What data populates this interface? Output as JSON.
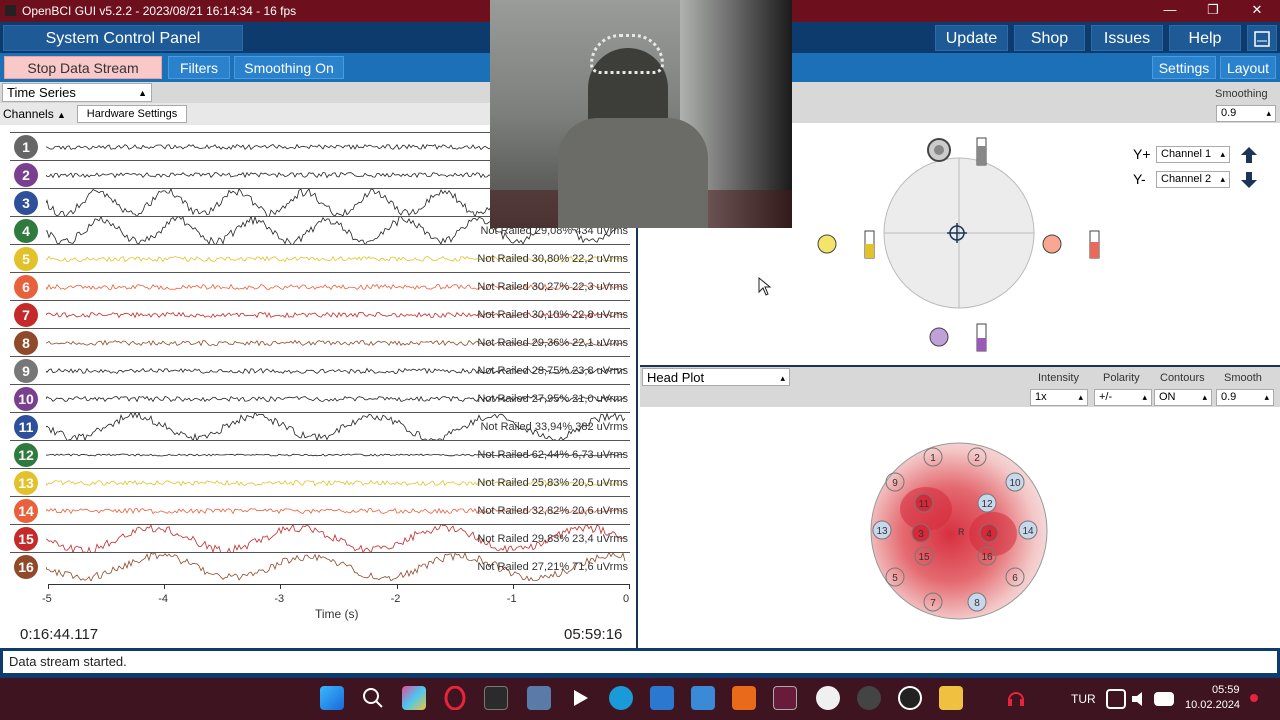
{
  "titlebar": {
    "title": "OpenBCI GUI v5.2.2 - 2023/08/21 16:14:34 - 16 fps",
    "minimize": "—",
    "restore": "❐",
    "close": "✕"
  },
  "nav": {
    "control_panel": "System Control Panel",
    "update": "Update",
    "shop": "Shop",
    "issues": "Issues",
    "help": "Help"
  },
  "toolbar": {
    "stop": "Stop Data Stream",
    "filters": "Filters",
    "smoothing": "Smoothing On",
    "settings": "Settings",
    "layout": "Layout"
  },
  "timeseries": {
    "widget": "Time Series",
    "channels_label": "Channels",
    "hardware_settings": "Hardware Settings",
    "channels": [
      {
        "n": "1",
        "color": "#666666",
        "info": "Not"
      },
      {
        "n": "2",
        "color": "#7a3f8f",
        "info": "Not"
      },
      {
        "n": "3",
        "color": "#2e4f9a",
        "info": "Not"
      },
      {
        "n": "4",
        "color": "#2e7a3f",
        "info": "Not Railed 29,08% 434 uVrms"
      },
      {
        "n": "5",
        "color": "#e3c12a",
        "info": "Not Railed 30,80% 22,2 uVrms"
      },
      {
        "n": "6",
        "color": "#e8603c",
        "info": "Not Railed 30,27% 22,3 uVrms"
      },
      {
        "n": "7",
        "color": "#c42a2a",
        "info": "Not Railed 30,10% 22,8 uVrms"
      },
      {
        "n": "8",
        "color": "#8f4a2a",
        "info": "Not Railed 29,36% 22,1 uVrms"
      },
      {
        "n": "9",
        "color": "#777777",
        "info": "Not Railed 28,75% 23,8 uVrms"
      },
      {
        "n": "10",
        "color": "#7a3f8f",
        "info": "Not Railed 27,95% 21,0 uVrms"
      },
      {
        "n": "11",
        "color": "#2e4f9a",
        "info": "Not Railed 33,94% 382 uVrms"
      },
      {
        "n": "12",
        "color": "#2e7a3f",
        "info": "Not Railed 62,44% 6,73 uVrms"
      },
      {
        "n": "13",
        "color": "#e3c12a",
        "info": "Not Railed 25,83% 20,5 uVrms"
      },
      {
        "n": "14",
        "color": "#e8603c",
        "info": "Not Railed 32,82% 20,6 uVrms"
      },
      {
        "n": "15",
        "color": "#c42a2a",
        "info": "Not Railed 29,83% 23,4 uVrms"
      },
      {
        "n": "16",
        "color": "#8f4a2a",
        "info": "Not Railed 27,21% 71,6 uVrms"
      }
    ],
    "x_ticks": [
      "-5",
      "-4",
      "-3",
      "-2",
      "-1",
      "0"
    ],
    "x_label": "Time (s)",
    "elapsed": "0:16:44.117",
    "remaining": "05:59:16"
  },
  "accel": {
    "smoothing_label": "Smoothing",
    "smoothing_value": "0.9",
    "yplus_label": "Y+",
    "yminus_label": "Y-",
    "yplus_channel": "Channel 1",
    "yminus_channel": "Channel 2"
  },
  "headplot": {
    "widget": "Head Plot",
    "intensity_label": "Intensity",
    "intensity_value": "1x",
    "polarity_label": "Polarity",
    "polarity_value": "+/-",
    "contours_label": "Contours",
    "contours_value": "ON",
    "smooth_label": "Smooth",
    "smooth_value": "0.9",
    "ref_label": "R",
    "electrodes": [
      "1",
      "2",
      "3",
      "4",
      "5",
      "6",
      "7",
      "8",
      "9",
      "10",
      "11",
      "12",
      "13",
      "14",
      "15",
      "16"
    ]
  },
  "status": {
    "message": "Data stream started."
  },
  "taskbar": {
    "lang": "TUR",
    "time": "05:59",
    "date": "10.02.2024"
  }
}
